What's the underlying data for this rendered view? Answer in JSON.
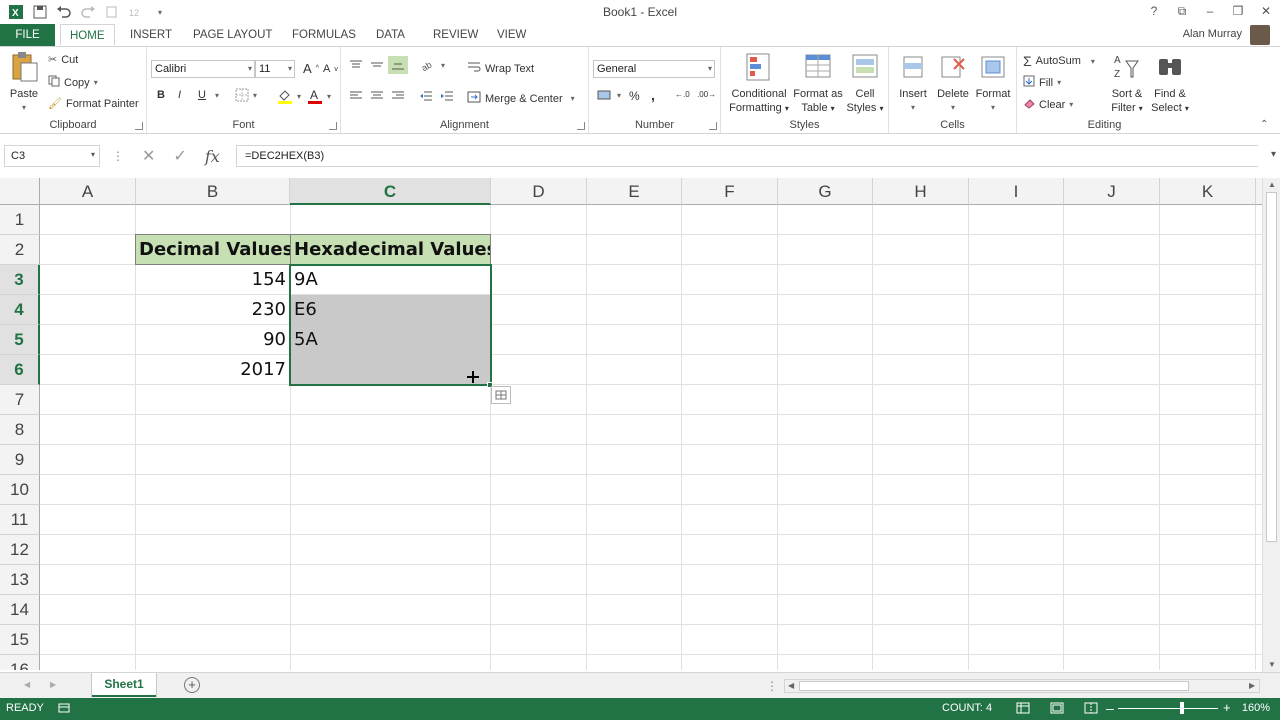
{
  "window": {
    "title": "Book1 - Excel",
    "user": "Alan Murray",
    "controls": [
      "?",
      "⧉",
      "–",
      "❐",
      "✕"
    ]
  },
  "tabs": [
    "FILE",
    "HOME",
    "INSERT",
    "PAGE LAYOUT",
    "FORMULAS",
    "DATA",
    "REVIEW",
    "VIEW"
  ],
  "ribbon": {
    "clipboard": {
      "paste": "Paste",
      "cut": "Cut",
      "copy": "Copy",
      "format_painter": "Format Painter",
      "label": "Clipboard"
    },
    "font": {
      "name": "Calibri",
      "size": "11",
      "bold": "B",
      "italic": "I",
      "underline": "U",
      "label": "Font"
    },
    "alignment": {
      "wrap_text": "Wrap Text",
      "merge_center": "Merge & Center",
      "label": "Alignment"
    },
    "number": {
      "format": "General",
      "label": "Number"
    },
    "styles": {
      "conditional": [
        "Conditional",
        "Formatting"
      ],
      "format_table": [
        "Format as",
        "Table"
      ],
      "cell_styles": [
        "Cell",
        "Styles"
      ],
      "label": "Styles"
    },
    "cells": {
      "insert": "Insert",
      "delete": "Delete",
      "format": "Format",
      "label": "Cells"
    },
    "editing": {
      "autosum": "AutoSum",
      "fill": "Fill",
      "clear": "Clear",
      "sort": [
        "Sort &",
        "Filter"
      ],
      "find": [
        "Find &",
        "Select"
      ],
      "label": "Editing"
    }
  },
  "formula_bar": {
    "name_box": "C3",
    "formula": "=DEC2HEX(B3)"
  },
  "columns": [
    "A",
    "B",
    "C",
    "D",
    "E",
    "F",
    "G",
    "H",
    "I",
    "J",
    "K"
  ],
  "rows": [
    "1",
    "2",
    "3",
    "4",
    "5",
    "6",
    "7",
    "8",
    "9",
    "10",
    "11",
    "12",
    "13",
    "14",
    "15",
    "16"
  ],
  "cells": {
    "B2": "Decimal Values",
    "C2": "Hexadecimal Values",
    "B3": "154",
    "B4": "230",
    "B5": "90",
    "B6": "2017",
    "C3": "9A",
    "C4": "E6",
    "C5": "5A",
    "C6": ""
  },
  "sheets": [
    "Sheet1"
  ],
  "status": {
    "mode": "READY",
    "count": "COUNT: 4",
    "zoom": "160%"
  },
  "colors": {
    "accent": "#217346",
    "header_fill": "#c6e0b4",
    "selection_shade": "#c9c9c9"
  }
}
